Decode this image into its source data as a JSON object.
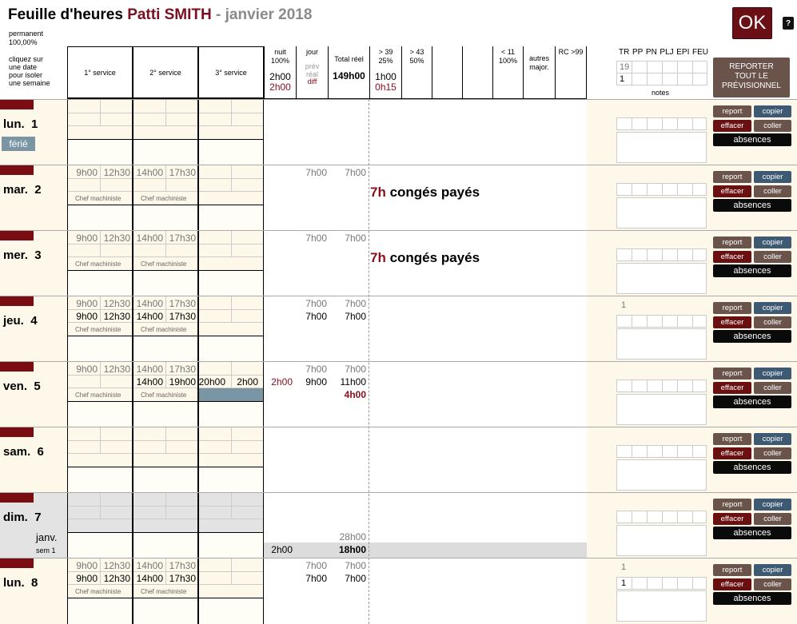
{
  "header": {
    "title_prefix": "Feuille d'heures",
    "employee": "Patti SMITH",
    "separator": "-",
    "month": "janvier 2018",
    "contract": "permanent",
    "rate": "100,00%",
    "hint_lines": [
      "cliquez sur",
      "une date",
      "pour isoler",
      "une semaine"
    ],
    "ok_label": "OK",
    "help_label": "?",
    "report_all_lines": [
      "REPORTER",
      "TOUT LE",
      "PRÉVISIONNEL"
    ]
  },
  "columns": {
    "services": [
      "1° service",
      "2° service",
      "3° service"
    ],
    "nuit": [
      "nuit",
      "100%"
    ],
    "jour": [
      "jour"
    ],
    "jour_sub": [
      "prév",
      "réal",
      "diff"
    ],
    "total": "Total réel",
    "gt39": [
      "> 39",
      "25%"
    ],
    "gt43": [
      "> 43",
      "50%"
    ],
    "lt11": [
      "< 11",
      "100%"
    ],
    "autres": [
      "autres",
      "major."
    ],
    "rc": "RC >99",
    "totals": {
      "nuit": "2h00",
      "nuit_diff": "2h00",
      "total": "149h00",
      "gt39": "1h00",
      "gt39_diff": "0h15"
    },
    "note_heads": [
      "TR",
      "PP",
      "PN",
      "PLJ",
      "EPI",
      "FEU"
    ],
    "note_vals": [
      "19",
      "1"
    ],
    "notes_label": "notes"
  },
  "buttons": {
    "report": "report",
    "copier": "copier",
    "effacer": "effacer",
    "coller": "coller",
    "absences": "absences"
  },
  "days": [
    {
      "name": "lun.",
      "num": "1",
      "ferie": "férié"
    },
    {
      "name": "mar.",
      "num": "2",
      "prev": [
        "9h00",
        "12h30",
        "14h00",
        "17h30"
      ],
      "job": "Chef machiniste",
      "jour_prev": "7h00",
      "total_prev": "7h00",
      "conge_h": "7h",
      "conge_label": "congés payés"
    },
    {
      "name": "mer.",
      "num": "3",
      "prev": [
        "9h00",
        "12h30",
        "14h00",
        "17h30"
      ],
      "job": "Chef machiniste",
      "jour_prev": "7h00",
      "total_prev": "7h00",
      "conge_h": "7h",
      "conge_label": "congés payés"
    },
    {
      "name": "jeu.",
      "num": "4",
      "prev": [
        "9h00",
        "12h30",
        "14h00",
        "17h30"
      ],
      "real": [
        "9h00",
        "12h30",
        "14h00",
        "17h30"
      ],
      "job": "Chef machiniste",
      "jour_prev": "7h00",
      "total_prev": "7h00",
      "jour_real": "7h00",
      "total_real": "7h00",
      "note_top": "1"
    },
    {
      "name": "ven.",
      "num": "5",
      "prev": [
        "9h00",
        "12h30",
        "14h00",
        "17h30"
      ],
      "real2": [
        "14h00",
        "19h00"
      ],
      "real3": [
        "20h00",
        "2h00"
      ],
      "job": "Chef machiniste",
      "jour_prev": "7h00",
      "total_prev": "7h00",
      "nuit_real": "2h00",
      "jour_real": "9h00",
      "total_real": "11h00",
      "total_diff": "4h00"
    },
    {
      "name": "sam.",
      "num": "6"
    },
    {
      "name": "dim.",
      "num": "7",
      "month_label": "janv.",
      "week_label": "sem 1",
      "week_total_prev": "28h00",
      "week_nuit": "2h00",
      "week_total": "18h00"
    },
    {
      "name": "lun.",
      "num": "8",
      "prev": [
        "9h00",
        "12h30",
        "14h00",
        "17h30"
      ],
      "real": [
        "9h00",
        "12h30",
        "14h00",
        "17h30"
      ],
      "job": "Chef machiniste",
      "jour_prev": "7h00",
      "total_prev": "7h00",
      "jour_real": "7h00",
      "total_real": "7h00",
      "note_top": "1",
      "note_val": "1"
    }
  ]
}
